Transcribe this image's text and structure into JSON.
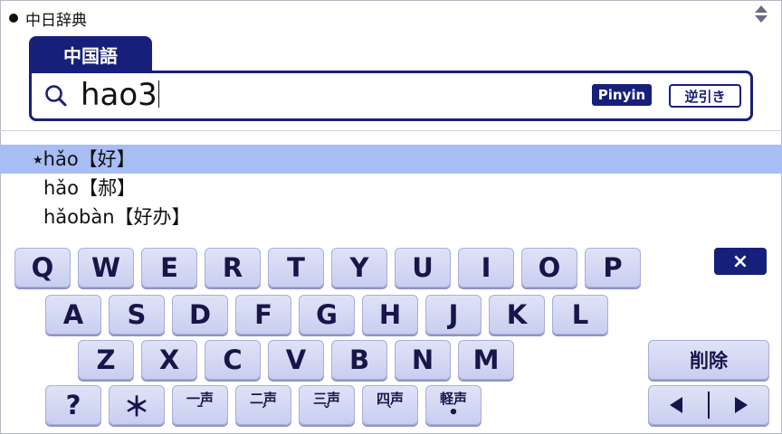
{
  "app": {
    "title": "中日辞典"
  },
  "tab": {
    "label": "中国語"
  },
  "search": {
    "value": "hao3",
    "pinyin_label": "Pinyin",
    "reverse_label": "逆引き"
  },
  "results": [
    {
      "marker": "★",
      "text": "hǎo【好】",
      "selected": true
    },
    {
      "marker": "",
      "text": "hǎo【郝】",
      "selected": false
    },
    {
      "marker": "",
      "text": "hǎobàn【好办】",
      "selected": false
    }
  ],
  "keyboard": {
    "row1": [
      "Q",
      "W",
      "E",
      "R",
      "T",
      "Y",
      "U",
      "I",
      "O",
      "P"
    ],
    "row2": [
      "A",
      "S",
      "D",
      "F",
      "G",
      "H",
      "J",
      "K",
      "L"
    ],
    "row3": [
      "Z",
      "X",
      "C",
      "V",
      "B",
      "N",
      "M"
    ],
    "row4_symbols": [
      "?",
      "＊"
    ],
    "tones": [
      {
        "label": "一声",
        "mark": "ˉ"
      },
      {
        "label": "二声",
        "mark": "ˊ"
      },
      {
        "label": "三声",
        "mark": "ˇ"
      },
      {
        "label": "四声",
        "mark": "ˋ"
      },
      {
        "label": "軽声",
        "mark": "•"
      }
    ],
    "clear_label": "×",
    "delete_label": "削除"
  },
  "colors": {
    "accent": "#16207a",
    "selected_row": "#a9bdf5",
    "key_face": "#d4d8f3"
  }
}
